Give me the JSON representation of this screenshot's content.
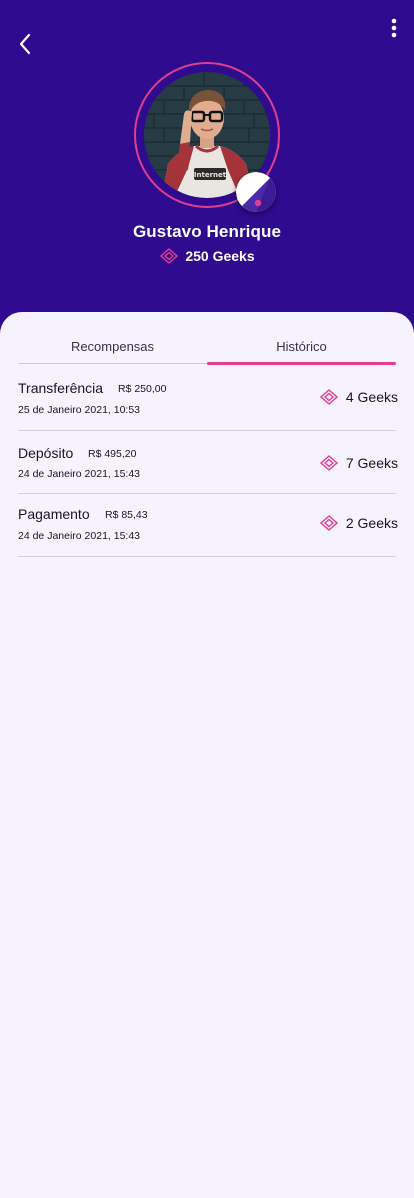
{
  "colors": {
    "header_bg": "#2f0b8f",
    "accent": "#e23d8f",
    "background": "#f6f3fe"
  },
  "header": {
    "back_icon": "chevron-left-icon",
    "menu_icon": "more-vertical-icon"
  },
  "profile": {
    "name": "Gustavo Henrique",
    "balance": "250 Geeks",
    "balance_icon": "diamond-icon"
  },
  "tabs": [
    {
      "label": "Recompensas",
      "active": false
    },
    {
      "label": "Histórico",
      "active": true
    }
  ],
  "history": [
    {
      "type": "Transferência",
      "amount": "R$ 250,00",
      "date": "25 de Janeiro 2021, 10:53",
      "geeks": "4 Geeks"
    },
    {
      "type": "Depósito",
      "amount": "R$ 495,20",
      "date": "24 de Janeiro 2021, 15:43",
      "geeks": "7 Geeks"
    },
    {
      "type": "Pagamento",
      "amount": "R$ 85,43",
      "date": "24 de Janeiro 2021, 15:43",
      "geeks": "2 Geeks"
    }
  ]
}
